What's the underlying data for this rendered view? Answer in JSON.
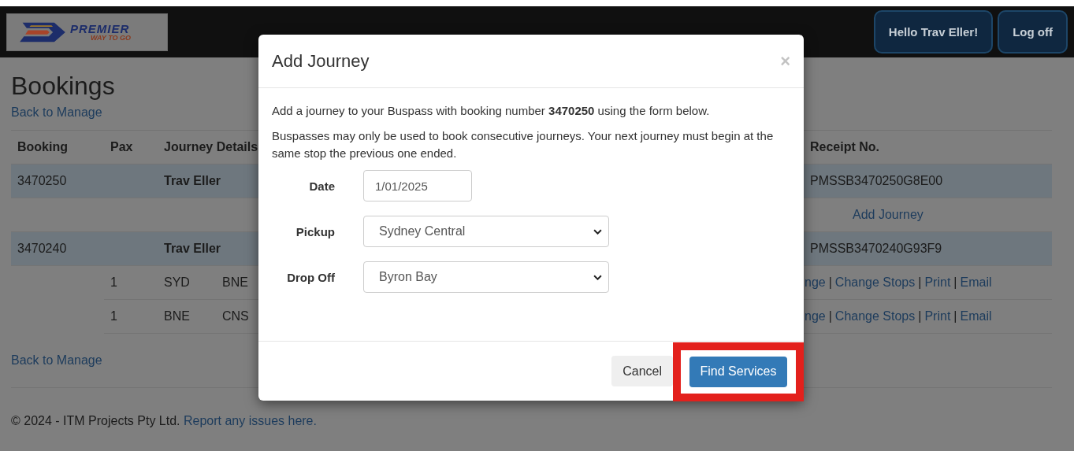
{
  "logo": {
    "name": "PREMIER",
    "tagline": "WAY TO GO"
  },
  "nav": {
    "greeting": "Hello Trav Eller!",
    "logout": "Log off"
  },
  "page_title": "Bookings",
  "back_link_top": "Back to Manage",
  "table": {
    "columns": [
      "Booking",
      "Pax",
      "Journey Details",
      "Receipt No."
    ],
    "rows": [
      {
        "kind": "booking",
        "booking": "3470250",
        "name": "Trav Eller",
        "receipt": "PMSSB3470250G8E00"
      },
      {
        "kind": "add",
        "link": "Add Journey"
      },
      {
        "kind": "booking",
        "booking": "3470240",
        "name": "Trav Eller",
        "receipt": "PMSSB3470240G93F9"
      },
      {
        "kind": "journey",
        "pax": "1",
        "from": "SYD",
        "to": "BNE",
        "separator": "|",
        "actions": [
          "nge",
          "Change Stops",
          "Print",
          "Email"
        ]
      },
      {
        "kind": "journey",
        "pax": "1",
        "from": "BNE",
        "to": "CNS",
        "separator": "|",
        "actions": [
          "nge",
          "Change Stops",
          "Print",
          "Email"
        ]
      }
    ]
  },
  "back_link_bottom": "Back to Manage",
  "footer": {
    "text": "© 2024 - ITM Projects Pty Ltd.",
    "link": "Report any issues here."
  },
  "modal": {
    "title": "Add Journey",
    "close": "×",
    "intro": "Add a journey to your Buspass with booking number **3470250** using the form below.",
    "note": "Buspasses may only be used to book consecutive journeys. Your next journey must begin at the same stop the previous one ended.",
    "fields": [
      {
        "kind": "text",
        "label": "Date",
        "value": "1/01/2025"
      },
      {
        "kind": "select",
        "label": "Pickup",
        "value": "Sydney Central"
      },
      {
        "kind": "select",
        "label": "Drop Off",
        "value": "Byron Bay"
      }
    ],
    "buttons": [
      {
        "kind": "secondary",
        "label": "Cancel",
        "highlighted": false
      },
      {
        "kind": "primary",
        "label": "Find Services",
        "highlighted": true
      }
    ]
  }
}
